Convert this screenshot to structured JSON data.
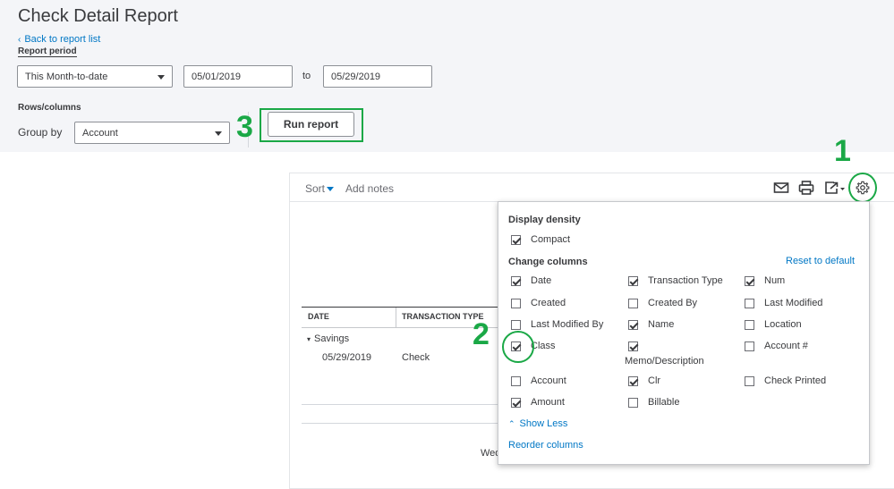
{
  "header": {
    "title": "Check Detail Report",
    "back_link": "Back to report list",
    "report_period_label": "Report period"
  },
  "filters": {
    "period_select": "This Month-to-date",
    "start_date": "05/01/2019",
    "to_label": "to",
    "end_date": "05/29/2019",
    "rows_columns_label": "Rows/columns",
    "group_by_label": "Group by",
    "group_by_value": "Account",
    "run_report": "Run report"
  },
  "annotations": {
    "step1": "1",
    "step2": "2",
    "step3": "3",
    "highlight_color": "#1aa846"
  },
  "toolbar": {
    "sort": "Sort",
    "add_notes": "Add notes",
    "icons": [
      "email-icon",
      "print-icon",
      "export-icon",
      "gear-icon"
    ]
  },
  "table": {
    "headers": [
      "DATE",
      "TRANSACTION TYPE"
    ],
    "group": "Savings",
    "rows": [
      {
        "date": "05/29/2019",
        "type": "Check"
      }
    ],
    "footer_partial": "Wed"
  },
  "settings_panel": {
    "display_density_title": "Display density",
    "compact": {
      "label": "Compact",
      "checked": true
    },
    "change_columns_title": "Change columns",
    "reset_link": "Reset to default",
    "columns": [
      {
        "label": "Date",
        "checked": true
      },
      {
        "label": "Transaction Type",
        "checked": true
      },
      {
        "label": "Num",
        "checked": true
      },
      {
        "label": "Created",
        "checked": false
      },
      {
        "label": "Created By",
        "checked": false
      },
      {
        "label": "Last Modified",
        "checked": false
      },
      {
        "label": "Last Modified By",
        "checked": false
      },
      {
        "label": "Name",
        "checked": true
      },
      {
        "label": "Location",
        "checked": false
      },
      {
        "label": "Class",
        "checked": true
      },
      {
        "label": "Memo/Description",
        "checked": true
      },
      {
        "label": "Account #",
        "checked": false
      },
      {
        "label": "Account",
        "checked": false
      },
      {
        "label": "Clr",
        "checked": true
      },
      {
        "label": "Check Printed",
        "checked": false
      },
      {
        "label": "Amount",
        "checked": true
      },
      {
        "label": "Billable",
        "checked": false
      }
    ],
    "show_less": "Show Less",
    "reorder": "Reorder columns"
  }
}
